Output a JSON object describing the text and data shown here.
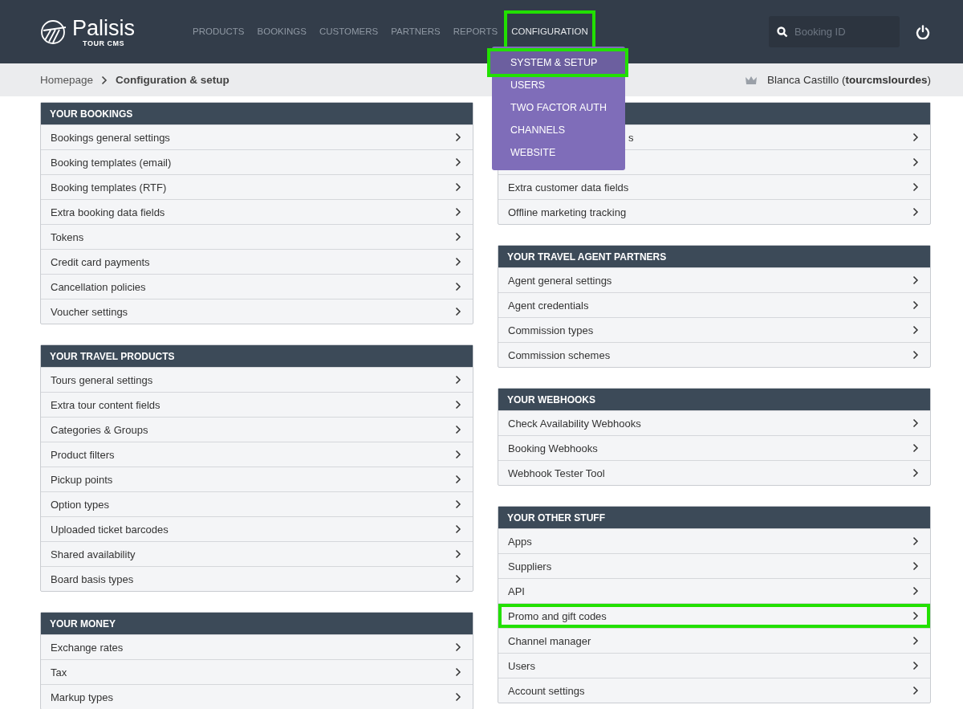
{
  "logo": {
    "name": "Palisis",
    "sub": "TOUR CMS"
  },
  "nav": [
    {
      "label": "PRODUCTS",
      "selected": false,
      "highlighted": false
    },
    {
      "label": "BOOKINGS",
      "selected": false,
      "highlighted": false
    },
    {
      "label": "CUSTOMERS",
      "selected": false,
      "highlighted": false
    },
    {
      "label": "PARTNERS",
      "selected": false,
      "highlighted": false
    },
    {
      "label": "REPORTS",
      "selected": false,
      "highlighted": false
    },
    {
      "label": "CONFIGURATION",
      "selected": true,
      "highlighted": true
    }
  ],
  "dropdown": [
    {
      "label": "SYSTEM & SETUP",
      "selected": true,
      "highlighted": true
    },
    {
      "label": "USERS",
      "selected": false,
      "highlighted": false
    },
    {
      "label": "TWO FACTOR AUTH",
      "selected": false,
      "highlighted": false
    },
    {
      "label": "CHANNELS",
      "selected": false,
      "highlighted": false
    },
    {
      "label": "WEBSITE",
      "selected": false,
      "highlighted": false
    }
  ],
  "search": {
    "placeholder": "Booking ID"
  },
  "breadcrumb": {
    "home": "Homepage",
    "current": "Configuration & setup"
  },
  "user": "Blanca Castillo (**tourcmslourdes**)",
  "columns": [
    {
      "panels": [
        {
          "title": "YOUR BOOKINGS",
          "items": [
            {
              "label": "Bookings general settings",
              "highlighted": false
            },
            {
              "label": "Booking templates (email)",
              "highlighted": false
            },
            {
              "label": "Booking templates (RTF)",
              "highlighted": false
            },
            {
              "label": "Extra booking data fields",
              "highlighted": false
            },
            {
              "label": "Tokens",
              "highlighted": false
            },
            {
              "label": "Credit card payments",
              "highlighted": false
            },
            {
              "label": "Cancellation policies",
              "highlighted": false
            },
            {
              "label": "Voucher settings",
              "highlighted": false
            }
          ]
        },
        {
          "title": "YOUR TRAVEL PRODUCTS",
          "items": [
            {
              "label": "Tours general settings",
              "highlighted": false
            },
            {
              "label": "Extra tour content fields",
              "highlighted": false
            },
            {
              "label": "Categories & Groups",
              "highlighted": false
            },
            {
              "label": "Product filters",
              "highlighted": false
            },
            {
              "label": "Pickup points",
              "highlighted": false
            },
            {
              "label": "Option types",
              "highlighted": false
            },
            {
              "label": "Uploaded ticket barcodes",
              "highlighted": false
            },
            {
              "label": "Shared availability",
              "highlighted": false
            },
            {
              "label": "Board basis types",
              "highlighted": false
            }
          ]
        },
        {
          "title": "YOUR MONEY",
          "items": [
            {
              "label": "Exchange rates",
              "highlighted": false
            },
            {
              "label": "Tax",
              "highlighted": false
            },
            {
              "label": "Markup types",
              "highlighted": false
            }
          ]
        }
      ]
    },
    {
      "panels": [
        {
          "items": [
            {
              "label": "s",
              "kind": "covered",
              "highlighted": false
            },
            {
              "kind": "hidden",
              "highlighted": false
            },
            {
              "label": "Extra customer data fields",
              "highlighted": false
            },
            {
              "label": "Offline marketing tracking",
              "highlighted": false
            }
          ]
        },
        {
          "title": "YOUR TRAVEL AGENT PARTNERS",
          "items": [
            {
              "label": "Agent general settings",
              "highlighted": false
            },
            {
              "label": "Agent credentials",
              "highlighted": false
            },
            {
              "label": "Commission types",
              "highlighted": false
            },
            {
              "label": "Commission schemes",
              "highlighted": false
            }
          ]
        },
        {
          "title": "YOUR WEBHOOKS",
          "items": [
            {
              "label": "Check Availability Webhooks",
              "highlighted": false
            },
            {
              "label": "Booking Webhooks",
              "highlighted": false
            },
            {
              "label": "Webhook Tester Tool",
              "highlighted": false
            }
          ]
        },
        {
          "title": "YOUR OTHER STUFF",
          "items": [
            {
              "label": "Apps",
              "highlighted": false
            },
            {
              "label": "Suppliers",
              "highlighted": false
            },
            {
              "label": "API",
              "highlighted": false
            },
            {
              "label": "Promo and gift codes",
              "highlighted": true
            },
            {
              "label": "Channel manager",
              "highlighted": false
            },
            {
              "label": "Users",
              "highlighted": false
            },
            {
              "label": "Account settings",
              "highlighted": false
            }
          ]
        }
      ]
    }
  ]
}
